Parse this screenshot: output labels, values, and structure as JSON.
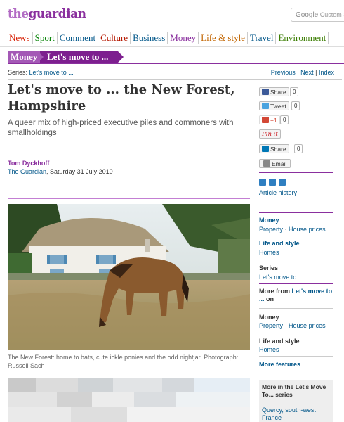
{
  "masthead": {
    "logo_the": "the",
    "logo_guardian": "guardian",
    "search_google": "Google",
    "search_placeholder": "Custom Search"
  },
  "nav": [
    "News",
    "Sport",
    "Comment",
    "Culture",
    "Business",
    "Money",
    "Life & style",
    "Travel",
    "Environment"
  ],
  "nav_colors": [
    "#d61d00",
    "#008000",
    "#005689",
    "#b51800",
    "#005689",
    "#8a2f9e",
    "#c26500",
    "#005689",
    "#3a7d00"
  ],
  "breadcrumbs": {
    "section": "Money",
    "series": "Let's move to ..."
  },
  "series_bar": {
    "label": "Series: ",
    "link": "Let's move to ...",
    "previous": "Previous",
    "next": "Next",
    "index": "Index"
  },
  "article": {
    "headline": "Let's move to ... the New Forest, Hampshire",
    "standfirst": "A queer mix of high-priced executive piles and commoners with smallholdings",
    "author": "Tom Dyckhoff",
    "publication": "The Guardian",
    "date": ", Saturday 31 July 2010",
    "caption": "The New Forest: home to bats, cute ickle ponies and the odd nightjar. Photograph: Russell Sach"
  },
  "share": [
    {
      "label": "Share",
      "count": "0",
      "icon": "facebook-icon",
      "color": "#3b5998"
    },
    {
      "label": "Tweet",
      "count": "0",
      "icon": "twitter-icon",
      "color": "#4aa3df"
    },
    {
      "label": "+1",
      "count": "0",
      "icon": "google-plus-icon",
      "color": "#d34836"
    },
    {
      "label": "Pin it",
      "count": "",
      "icon": "pinterest-icon",
      "color": "#cb2027"
    },
    {
      "label": "Share",
      "count": "0",
      "icon": "linkedin-icon",
      "color": "#0077b5"
    },
    {
      "label": "Email",
      "count": "",
      "icon": "email-icon",
      "color": "#888888"
    }
  ],
  "sidebar": {
    "article_history": "Article history",
    "money": {
      "title": "Money",
      "property": "Property",
      "house_prices": "House prices"
    },
    "life_style": {
      "title": "Life and style",
      "homes": "Homes"
    },
    "series": {
      "title": "Series",
      "link": "Let's move to ..."
    },
    "more_from": {
      "prefix": "More from ",
      "link": "Let's move to ...",
      "suffix": " on"
    },
    "money2": {
      "title": "Money",
      "property": "Property",
      "house_prices": "House prices"
    },
    "life_style2": {
      "title": "Life and style",
      "homes": "Homes"
    },
    "more_features": "More features",
    "more_series": {
      "title": "More in the Let's Move To... series",
      "link": "Quercy, south-west France"
    }
  },
  "colors": {
    "brand": "#8a2f9e",
    "link": "#005689",
    "headline": "#333333"
  }
}
